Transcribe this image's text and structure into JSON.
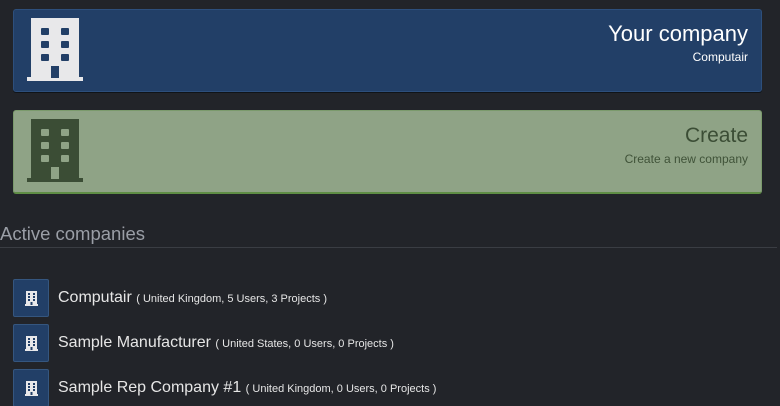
{
  "your_company": {
    "title": "Your company",
    "subtitle": "Computair",
    "icon": "building-icon"
  },
  "create": {
    "title": "Create",
    "subtitle": "Create a new company",
    "icon": "building-icon"
  },
  "active": {
    "heading": "Active companies",
    "companies": [
      {
        "name": "Computair",
        "meta": "( United Kingdom, 5 Users, 3 Projects )",
        "icon": "building-icon"
      },
      {
        "name": "Sample Manufacturer",
        "meta": "( United States, 0 Users, 0 Projects )",
        "icon": "building-icon"
      },
      {
        "name": "Sample Rep Company #1",
        "meta": "( United Kingdom, 0 Users, 0 Projects )",
        "icon": "building-icon"
      }
    ]
  },
  "colors": {
    "company_card": "#223f67",
    "create_card": "#8fa386",
    "background": "#222429"
  }
}
